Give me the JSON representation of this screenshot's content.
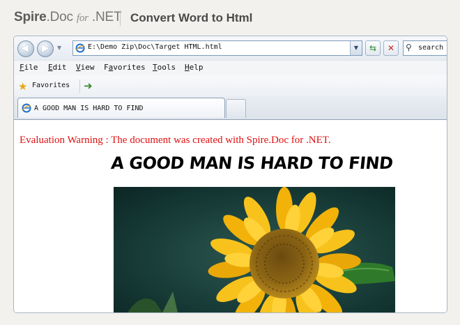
{
  "banner": {
    "brand_part1": "Spire",
    "brand_part2": ".Doc",
    "brand_part3": "for",
    "brand_part4": ".NET",
    "title": "Convert Word to Html"
  },
  "browser": {
    "address": "E:\\Demo Zip\\Doc\\Target HTML.html",
    "search_text": "search",
    "menu": [
      "File",
      "Edit",
      "View",
      "Favorites",
      "Tools",
      "Help"
    ],
    "menu_accel": [
      "F",
      "E",
      "V",
      "a",
      "T",
      "H"
    ],
    "favorites_label": "Favorites",
    "tab_title": "A GOOD MAN IS HARD TO FIND"
  },
  "document": {
    "warning": "Evaluation Warning : The document was created with Spire.Doc for .NET.",
    "title": "A GOOD MAN IS HARD TO FIND"
  },
  "colors": {
    "warning": "#e01010",
    "accent": "#7e9cb8"
  },
  "icons": {
    "back": "back-arrow-icon",
    "forward": "forward-arrow-icon",
    "page": "ie-page-icon",
    "refresh": "refresh-icon",
    "stop": "stop-icon",
    "search": "search-icon",
    "favorites": "star-icon",
    "add_favorite": "add-favorite-icon"
  }
}
